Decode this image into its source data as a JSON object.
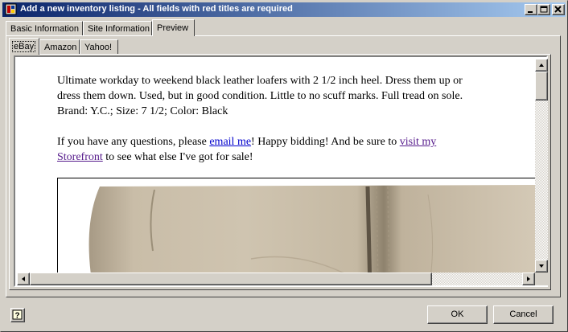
{
  "window": {
    "title": "Add a new inventory listing - All fields with red titles are required"
  },
  "tabs": [
    {
      "label": "Basic Information",
      "active": false
    },
    {
      "label": "Site Information",
      "active": false
    },
    {
      "label": "Preview",
      "active": true
    }
  ],
  "subtabs": [
    {
      "label": "eBay",
      "active": true
    },
    {
      "label": "Amazon",
      "active": false
    },
    {
      "label": "Yahoo!",
      "active": false
    }
  ],
  "preview": {
    "description_line1": "Ultimate workday to weekend black leather loafers with 2 1/2 inch heel. Dress them up or",
    "description_line2": "dress them down. Used, but in good condition. Little to no scuff marks. Full tread on sole.",
    "description_line3": "Brand: Y.C.; Size: 7 1/2; Color: Black",
    "contact_prefix": "If you have any questions, please ",
    "email_link": "email me",
    "contact_middle": "! Happy bidding! And be sure to ",
    "storefront_link_1": "visit my",
    "storefront_link_2": "Storefront",
    "contact_suffix": " to see what else I've got for sale!"
  },
  "buttons": {
    "ok": "OK",
    "cancel": "Cancel"
  },
  "icons": {
    "app": "app-icon",
    "help": "help-icon"
  }
}
